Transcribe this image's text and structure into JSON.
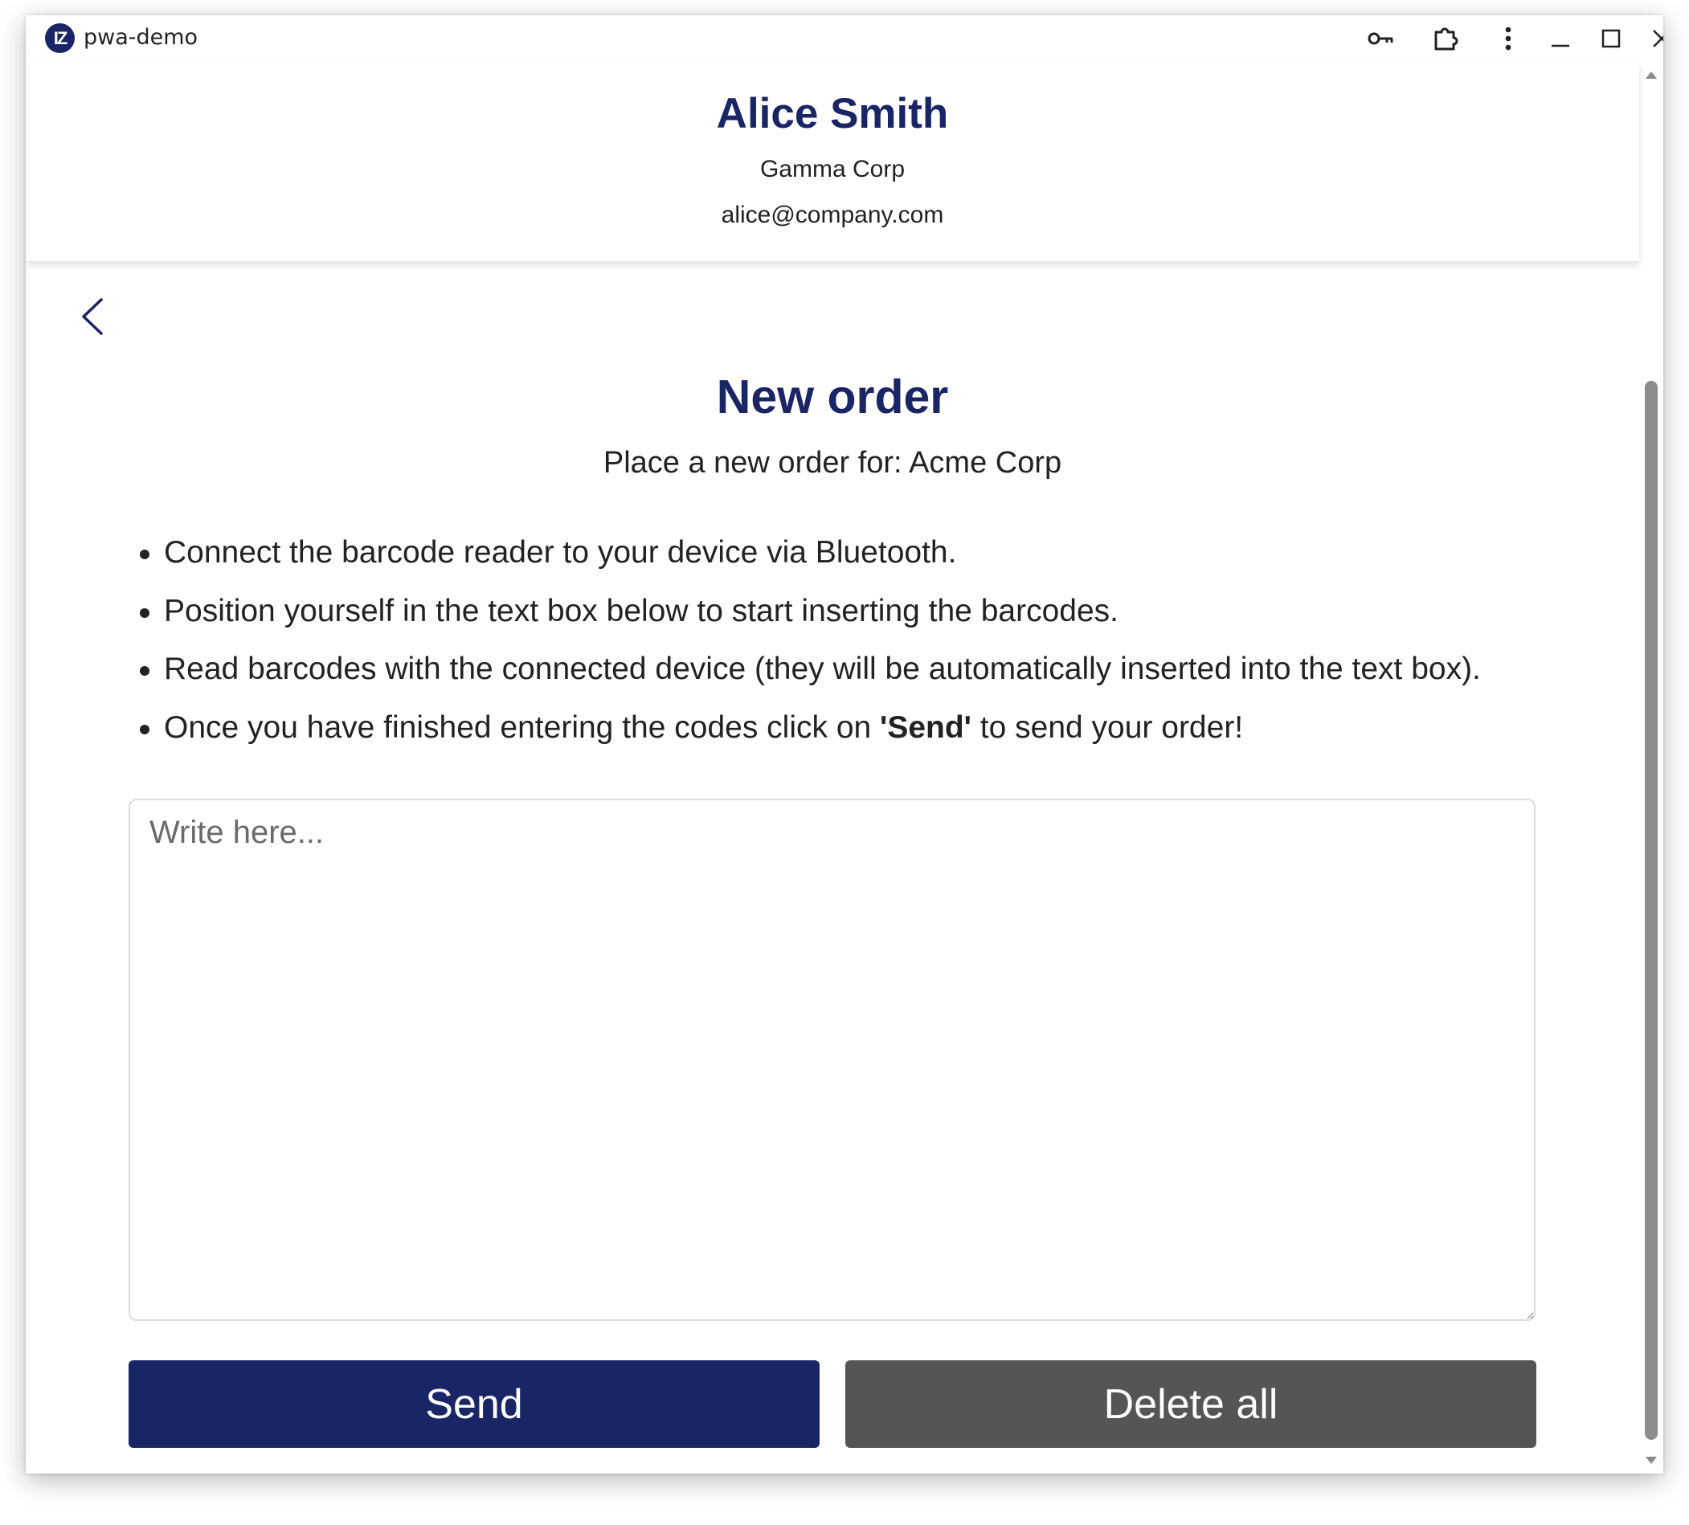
{
  "window": {
    "title": "pwa-demo",
    "logo_text": "IZ"
  },
  "titlebar_icons": [
    "key-icon",
    "extension-icon",
    "more-vert-icon",
    "minimize-icon",
    "maximize-icon",
    "close-icon"
  ],
  "header": {
    "name": "Alice Smith",
    "company": "Gamma Corp",
    "email": "alice@company.com"
  },
  "page": {
    "title": "New order",
    "subtitle": "Place a new order for: Acme Corp",
    "instructions": [
      "Connect the barcode reader to your device via Bluetooth.",
      "Position yourself in the text box below to start inserting the barcodes.",
      "Read barcodes with the connected device (they will be automatically inserted into the text box)."
    ],
    "instruction_last": {
      "before": "Once you have finished entering the codes click on ",
      "bold": "'Send'",
      "after": " to send your order!"
    }
  },
  "form": {
    "placeholder": "Write here...",
    "value": "",
    "send_label": "Send",
    "delete_label": "Delete all"
  },
  "colors": {
    "primary": "#1a2566",
    "secondary_button": "#555555",
    "text": "#222222"
  }
}
